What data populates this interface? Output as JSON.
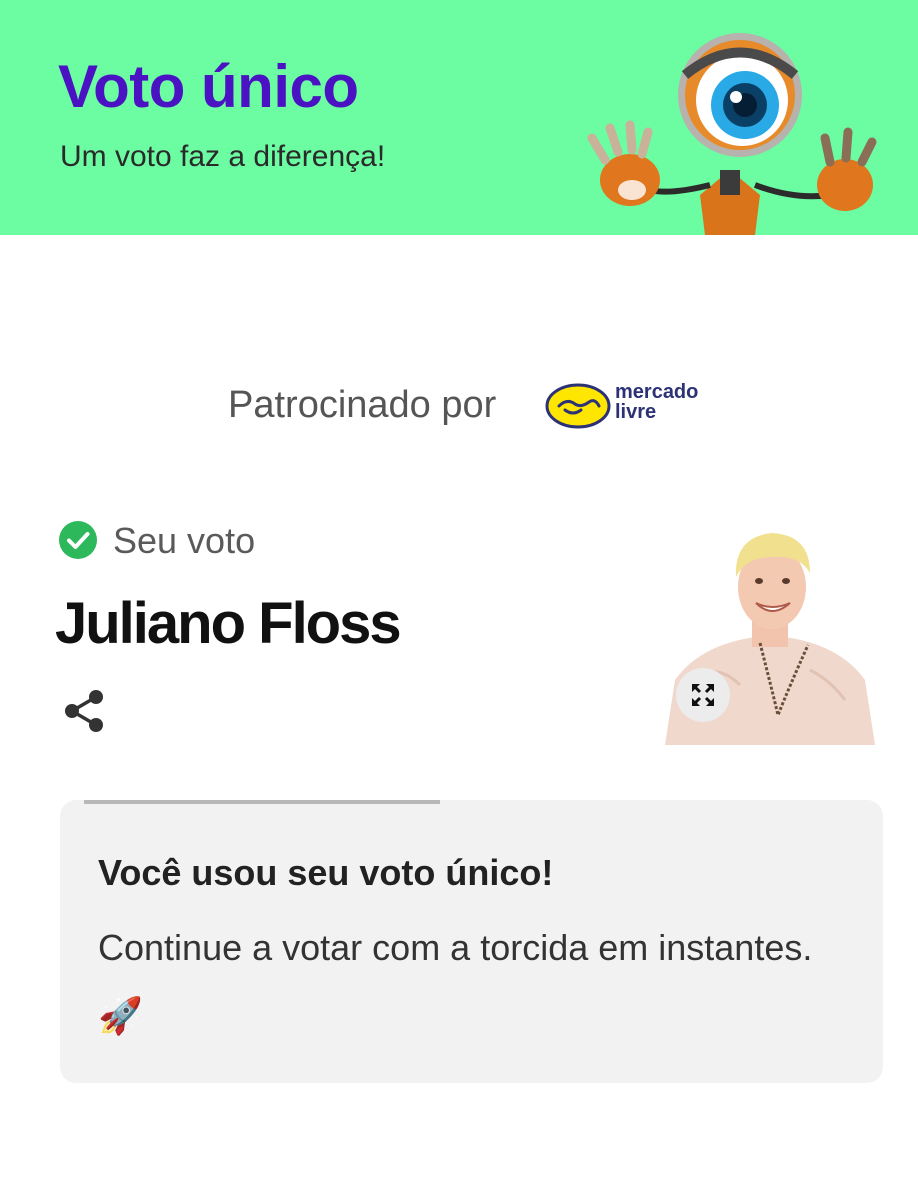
{
  "header": {
    "title": "Voto único",
    "subtitle": "Um voto faz a diferença!",
    "background": "#6cfca2",
    "title_color": "#4b12c4",
    "mascot_icon": "big-brother-eye-mascot"
  },
  "sponsor": {
    "label": "Patrocinado por",
    "logo_line1": "mercado",
    "logo_line2": "livre",
    "logo_color": "#ffe600"
  },
  "vote": {
    "label": "Seu voto",
    "candidate": "Juliano Floss",
    "check_icon": "check-circle-icon",
    "check_color": "#2eb85c",
    "share_icon": "share-icon",
    "expand_icon": "expand-icon"
  },
  "notice": {
    "title": "Você usou seu voto único!",
    "body": "Continue a votar com a torcida em instantes. 🚀",
    "background": "#f2f2f2"
  }
}
